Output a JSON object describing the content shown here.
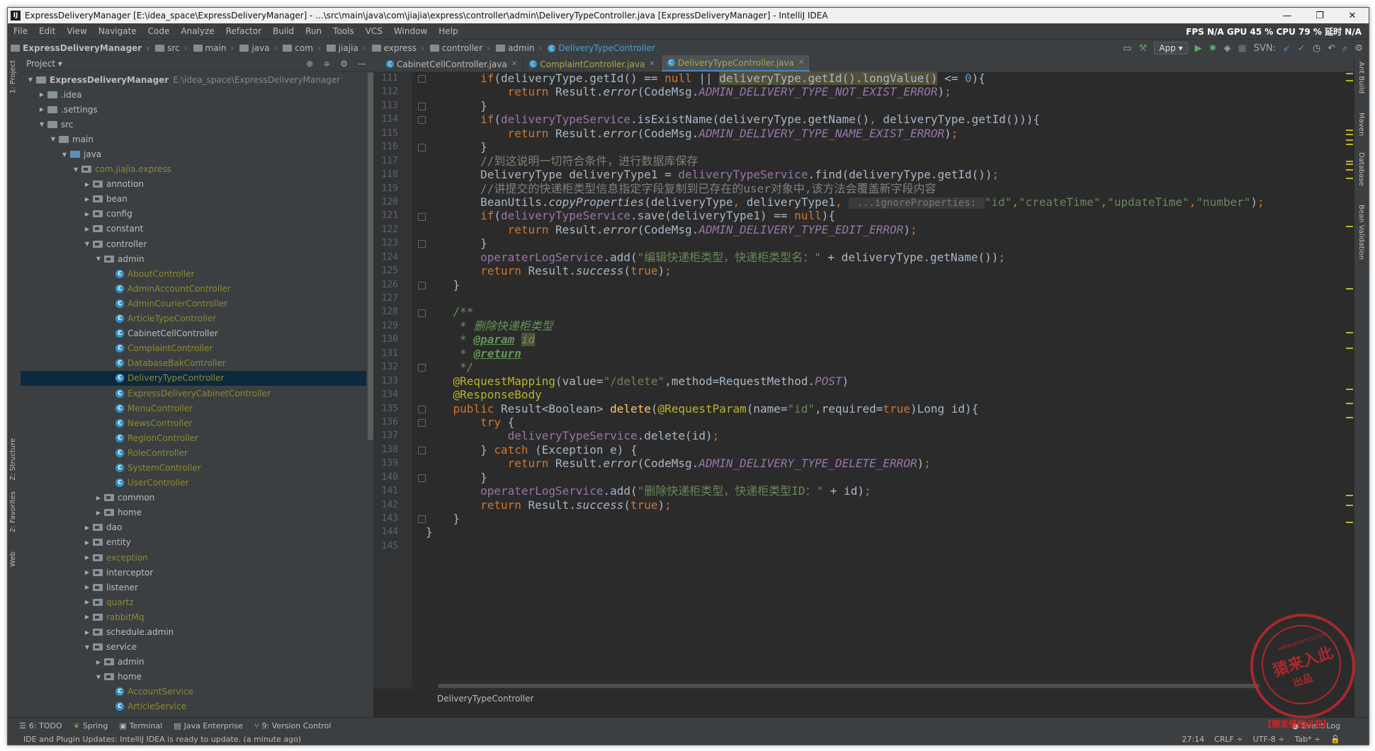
{
  "window": {
    "title": "ExpressDeliveryManager [E:\\idea_space\\ExpressDeliveryManager] - ...\\src\\main\\java\\com\\jiajia\\express\\controller\\admin\\DeliveryTypeController.java [ExpressDeliveryManager] - IntelliJ IDEA",
    "logo_text": "IJ",
    "min": "—",
    "max": "❐",
    "close": "✕"
  },
  "menu": {
    "items": [
      "File",
      "Edit",
      "View",
      "Navigate",
      "Code",
      "Analyze",
      "Refactor",
      "Build",
      "Run",
      "Tools",
      "VCS",
      "Window",
      "Help"
    ],
    "perf": "FPS  N/A  GPU  45 %  CPU  79 %  延时  N/A"
  },
  "nav": {
    "crumbs": [
      "ExpressDeliveryManager",
      "src",
      "main",
      "java",
      "com",
      "jiajia",
      "express",
      "controller",
      "admin",
      "DeliveryTypeController"
    ],
    "run_config": "App",
    "svn_label": "SVN:"
  },
  "left_strip": {
    "project": "1: Project",
    "structure": "Z: Structure",
    "favorites": "2: Favorites",
    "web": "Web"
  },
  "right_strip": {
    "ant": "Ant Build",
    "maven": "Maven",
    "database": "Database",
    "bean": "Bean Validation"
  },
  "project_panel": {
    "title": "Project ▾",
    "tree": [
      {
        "depth": 0,
        "arrow": "▼",
        "icon": "module",
        "name": "ExpressDeliveryManager",
        "path": "E:\\idea_space\\ExpressDeliveryManager",
        "style": "mod"
      },
      {
        "depth": 1,
        "arrow": "▶",
        "icon": "folder",
        "name": ".idea",
        "style": "white"
      },
      {
        "depth": 1,
        "arrow": "▶",
        "icon": "folder",
        "name": ".settings",
        "style": "white"
      },
      {
        "depth": 1,
        "arrow": "▼",
        "icon": "folder",
        "name": "src",
        "style": "white"
      },
      {
        "depth": 2,
        "arrow": "▼",
        "icon": "folder",
        "name": "main",
        "style": "white"
      },
      {
        "depth": 3,
        "arrow": "▼",
        "icon": "src",
        "name": "java",
        "style": "white"
      },
      {
        "depth": 4,
        "arrow": "▼",
        "icon": "pkg",
        "name": "com.jiajia.express",
        "style": "olive"
      },
      {
        "depth": 5,
        "arrow": "▶",
        "icon": "pkg",
        "name": "annotion",
        "style": "white"
      },
      {
        "depth": 5,
        "arrow": "▶",
        "icon": "pkg",
        "name": "bean",
        "style": "white"
      },
      {
        "depth": 5,
        "arrow": "▶",
        "icon": "pkg",
        "name": "config",
        "style": "white"
      },
      {
        "depth": 5,
        "arrow": "▶",
        "icon": "pkg",
        "name": "constant",
        "style": "white"
      },
      {
        "depth": 5,
        "arrow": "▼",
        "icon": "pkg",
        "name": "controller",
        "style": "white"
      },
      {
        "depth": 6,
        "arrow": "▼",
        "icon": "pkg",
        "name": "admin",
        "style": "white"
      },
      {
        "depth": 7,
        "arrow": "",
        "icon": "class",
        "name": "AboutController",
        "style": "olive"
      },
      {
        "depth": 7,
        "arrow": "",
        "icon": "class",
        "name": "AdminAccountController",
        "style": "olive"
      },
      {
        "depth": 7,
        "arrow": "",
        "icon": "class",
        "name": "AdminCourierController",
        "style": "olive"
      },
      {
        "depth": 7,
        "arrow": "",
        "icon": "class",
        "name": "ArticleTypeController",
        "style": "olive"
      },
      {
        "depth": 7,
        "arrow": "",
        "icon": "class",
        "name": "CabinetCellController",
        "style": "white"
      },
      {
        "depth": 7,
        "arrow": "",
        "icon": "class",
        "name": "ComplaintController",
        "style": "olive"
      },
      {
        "depth": 7,
        "arrow": "",
        "icon": "class",
        "name": "DatabaseBakController",
        "style": "olive"
      },
      {
        "depth": 7,
        "arrow": "",
        "icon": "class",
        "name": "DeliveryTypeController",
        "style": "olive",
        "selected": true
      },
      {
        "depth": 7,
        "arrow": "",
        "icon": "class",
        "name": "ExpressDeliveryCabinetController",
        "style": "olive"
      },
      {
        "depth": 7,
        "arrow": "",
        "icon": "class",
        "name": "MenuController",
        "style": "olive"
      },
      {
        "depth": 7,
        "arrow": "",
        "icon": "class",
        "name": "NewsController",
        "style": "olive"
      },
      {
        "depth": 7,
        "arrow": "",
        "icon": "class",
        "name": "RegionController",
        "style": "olive"
      },
      {
        "depth": 7,
        "arrow": "",
        "icon": "class",
        "name": "RoleController",
        "style": "olive"
      },
      {
        "depth": 7,
        "arrow": "",
        "icon": "class",
        "name": "SystemController",
        "style": "olive"
      },
      {
        "depth": 7,
        "arrow": "",
        "icon": "class",
        "name": "UserController",
        "style": "olive"
      },
      {
        "depth": 6,
        "arrow": "▶",
        "icon": "pkg",
        "name": "common",
        "style": "white"
      },
      {
        "depth": 6,
        "arrow": "▶",
        "icon": "pkg",
        "name": "home",
        "style": "white"
      },
      {
        "depth": 5,
        "arrow": "▶",
        "icon": "pkg",
        "name": "dao",
        "style": "white"
      },
      {
        "depth": 5,
        "arrow": "▶",
        "icon": "pkg",
        "name": "entity",
        "style": "white"
      },
      {
        "depth": 5,
        "arrow": "▶",
        "icon": "pkg",
        "name": "exception",
        "style": "olive"
      },
      {
        "depth": 5,
        "arrow": "▶",
        "icon": "pkg",
        "name": "interceptor",
        "style": "white"
      },
      {
        "depth": 5,
        "arrow": "▶",
        "icon": "pkg",
        "name": "listener",
        "style": "white"
      },
      {
        "depth": 5,
        "arrow": "▶",
        "icon": "pkg",
        "name": "quartz",
        "style": "olive"
      },
      {
        "depth": 5,
        "arrow": "▶",
        "icon": "pkg",
        "name": "rabbitMq",
        "style": "olive"
      },
      {
        "depth": 5,
        "arrow": "▶",
        "icon": "pkg",
        "name": "schedule.admin",
        "style": "white"
      },
      {
        "depth": 5,
        "arrow": "▼",
        "icon": "pkg",
        "name": "service",
        "style": "white"
      },
      {
        "depth": 6,
        "arrow": "▶",
        "icon": "pkg",
        "name": "admin",
        "style": "white"
      },
      {
        "depth": 6,
        "arrow": "▼",
        "icon": "pkg",
        "name": "home",
        "style": "white"
      },
      {
        "depth": 7,
        "arrow": "",
        "icon": "class",
        "name": "AccountService",
        "style": "olive"
      },
      {
        "depth": 7,
        "arrow": "",
        "icon": "class",
        "name": "ArticleService",
        "style": "olive"
      }
    ]
  },
  "editor": {
    "tabs": [
      {
        "label": "CabinetCellController.java",
        "style": "white"
      },
      {
        "label": "ComplaintController.java",
        "style": "olive"
      },
      {
        "label": "DeliveryTypeController.java",
        "style": "active"
      }
    ],
    "line_numbers": [
      "111",
      "112",
      "113",
      "114",
      "115",
      "116",
      "117",
      "118",
      "119",
      "120",
      "121",
      "122",
      "123",
      "124",
      "125",
      "126",
      "127",
      "128",
      "129",
      "130",
      "131",
      "132",
      "133",
      "134",
      "135",
      "136",
      "137",
      "138",
      "139",
      "140",
      "141",
      "142",
      "143",
      "144",
      "145"
    ],
    "lines": [
      [
        [
          "        "
        ],
        [
          "if",
          "k"
        ],
        [
          "(deliveryType.getId() == "
        ],
        [
          "null",
          "k"
        ],
        [
          " || "
        ],
        [
          "deliveryType.getId().longValue()",
          "hl2"
        ],
        [
          " <= "
        ],
        [
          "0",
          "n"
        ],
        [
          "){"
        ]
      ],
      [
        [
          "            "
        ],
        [
          "return",
          "k"
        ],
        [
          " Result."
        ],
        [
          "error",
          "it"
        ],
        [
          "(CodeMsg."
        ],
        [
          "ADMIN_DELIVERY_TYPE_NOT_EXIST_ERROR",
          "f it"
        ],
        [
          ")"
        ],
        [
          ";",
          "k"
        ]
      ],
      [
        [
          "        }"
        ]
      ],
      [
        [
          "        "
        ],
        [
          "if",
          "k"
        ],
        [
          "("
        ],
        [
          "deliveryTypeService",
          "f"
        ],
        [
          ".isExistName(deliveryType.getName()"
        ],
        [
          ", ",
          "k"
        ],
        [
          "deliveryType.getId())){"
        ]
      ],
      [
        [
          "            "
        ],
        [
          "return",
          "k"
        ],
        [
          " Result."
        ],
        [
          "error",
          "it"
        ],
        [
          "(CodeMsg."
        ],
        [
          "ADMIN_DELIVERY_TYPE_NAME_EXIST_ERROR",
          "f it"
        ],
        [
          ")"
        ],
        [
          ";",
          "k"
        ]
      ],
      [
        [
          "        }"
        ]
      ],
      [
        [
          "        "
        ],
        [
          "//到这说明一切符合条件，进行数据库保存",
          "c"
        ]
      ],
      [
        [
          "        DeliveryType deliveryType1 = "
        ],
        [
          "deliveryTypeService",
          "f"
        ],
        [
          ".find(deliveryType.getId())"
        ],
        [
          ";",
          "k"
        ]
      ],
      [
        [
          "        "
        ],
        [
          "//讲提交的快递柜类型信息指定字段复制到已存在的user对象中,该方法会覆盖新字段内容",
          "c"
        ]
      ],
      [
        [
          "        BeanUtils."
        ],
        [
          "copyProperties",
          "it"
        ],
        [
          "(deliveryType"
        ],
        [
          ", ",
          "k"
        ],
        [
          "deliveryType1"
        ],
        [
          ", ",
          "k"
        ],
        [
          " ...ignoreProperties: ",
          "hint"
        ],
        [
          "\"id\"",
          "s"
        ],
        [
          ",",
          "k"
        ],
        [
          "\"createTime\"",
          "s"
        ],
        [
          ",",
          "k"
        ],
        [
          "\"updateTime\"",
          "s"
        ],
        [
          ",",
          "k"
        ],
        [
          "\"number\"",
          "s"
        ],
        [
          ")"
        ],
        [
          ";",
          "k"
        ]
      ],
      [
        [
          "        "
        ],
        [
          "if",
          "k"
        ],
        [
          "("
        ],
        [
          "deliveryTypeService",
          "f"
        ],
        [
          ".save(deliveryType1) == "
        ],
        [
          "null",
          "k"
        ],
        [
          "){"
        ]
      ],
      [
        [
          "            "
        ],
        [
          "return",
          "k"
        ],
        [
          " Result."
        ],
        [
          "error",
          "it"
        ],
        [
          "(CodeMsg."
        ],
        [
          "ADMIN_DELIVERY_TYPE_EDIT_ERROR",
          "f it"
        ],
        [
          ")"
        ],
        [
          ";",
          "k"
        ]
      ],
      [
        [
          "        }"
        ]
      ],
      [
        [
          "        "
        ],
        [
          "operaterLogService",
          "f"
        ],
        [
          ".add("
        ],
        [
          "\"编辑快递柜类型，快递柜类型名：\"",
          "s"
        ],
        [
          " + deliveryType.getName())"
        ],
        [
          ";",
          "k"
        ]
      ],
      [
        [
          "        "
        ],
        [
          "return",
          "k"
        ],
        [
          " Result."
        ],
        [
          "success",
          "it"
        ],
        [
          "("
        ],
        [
          "true",
          "k"
        ],
        [
          ")"
        ],
        [
          ";",
          "k"
        ]
      ],
      [
        [
          "    }"
        ]
      ],
      [
        [
          ""
        ]
      ],
      [
        [
          "    "
        ],
        [
          "/**",
          "d"
        ]
      ],
      [
        [
          "     * ",
          "d"
        ],
        [
          "删除快递柜类型",
          "d"
        ]
      ],
      [
        [
          "     * ",
          "d"
        ],
        [
          "@param",
          "dt"
        ],
        [
          " "
        ],
        [
          "id",
          "hl2 d"
        ]
      ],
      [
        [
          "     * ",
          "d"
        ],
        [
          "@return",
          "dt"
        ]
      ],
      [
        [
          "     */",
          "d"
        ]
      ],
      [
        [
          "    "
        ],
        [
          "@RequestMapping",
          "a"
        ],
        [
          "(value="
        ],
        [
          "\"/delete\"",
          "s"
        ],
        [
          ","
        ],
        [
          "method=RequestMethod."
        ],
        [
          "POST",
          "f it"
        ],
        [
          ")"
        ]
      ],
      [
        [
          "    "
        ],
        [
          "@ResponseBody",
          "a"
        ]
      ],
      [
        [
          "    "
        ],
        [
          "public",
          "k"
        ],
        [
          " Result<Boolean> "
        ],
        [
          "delete",
          "m"
        ],
        [
          "("
        ],
        [
          "@RequestParam",
          "a"
        ],
        [
          "(name="
        ],
        [
          "\"id\"",
          "s"
        ],
        [
          ",required="
        ],
        [
          "true",
          "k"
        ],
        [
          ")Long id){"
        ]
      ],
      [
        [
          "        "
        ],
        [
          "try",
          "k"
        ],
        [
          " {"
        ]
      ],
      [
        [
          "            "
        ],
        [
          "deliveryTypeService",
          "f"
        ],
        [
          ".delete(id)"
        ],
        [
          ";",
          "k"
        ]
      ],
      [
        [
          "        } "
        ],
        [
          "catch",
          "k"
        ],
        [
          " (Exception e) {"
        ]
      ],
      [
        [
          "            "
        ],
        [
          "return",
          "k"
        ],
        [
          " Result."
        ],
        [
          "error",
          "it"
        ],
        [
          "(CodeMsg."
        ],
        [
          "ADMIN_DELIVERY_TYPE_DELETE_ERROR",
          "f it"
        ],
        [
          ")"
        ],
        [
          ";",
          "k"
        ]
      ],
      [
        [
          "        }"
        ]
      ],
      [
        [
          "        "
        ],
        [
          "operaterLogService",
          "f"
        ],
        [
          ".add("
        ],
        [
          "\"删除快递柜类型，快递柜类型ID：\"",
          "s"
        ],
        [
          " + id)"
        ],
        [
          ";",
          "k"
        ]
      ],
      [
        [
          "        "
        ],
        [
          "return",
          "k"
        ],
        [
          " Result."
        ],
        [
          "success",
          "it"
        ],
        [
          "("
        ],
        [
          "true",
          "k"
        ],
        [
          ")"
        ],
        [
          ";",
          "k"
        ]
      ],
      [
        [
          "    }"
        ]
      ],
      [
        [
          "}"
        ]
      ],
      [
        [
          ""
        ]
      ]
    ],
    "breadcrumb": "DeliveryTypeController"
  },
  "bottom_tools": [
    "6: TODO",
    "Spring",
    "Terminal",
    "Java Enterprise",
    "9: Version Control"
  ],
  "status": {
    "message": "IDE and Plugin Updates: IntelliJ IDEA is ready to update. (a minute ago)",
    "position": "27:14",
    "line_sep": "CRLF ÷",
    "encoding": "UTF-8 ÷",
    "indent": "Tab* ÷",
    "event_log": "Event Log"
  },
  "stamp": {
    "line1": "猿来入此",
    "line2": "出品",
    "url": "www.yuanrcc.com",
    "footnote": "【侧发侵权必究】"
  }
}
